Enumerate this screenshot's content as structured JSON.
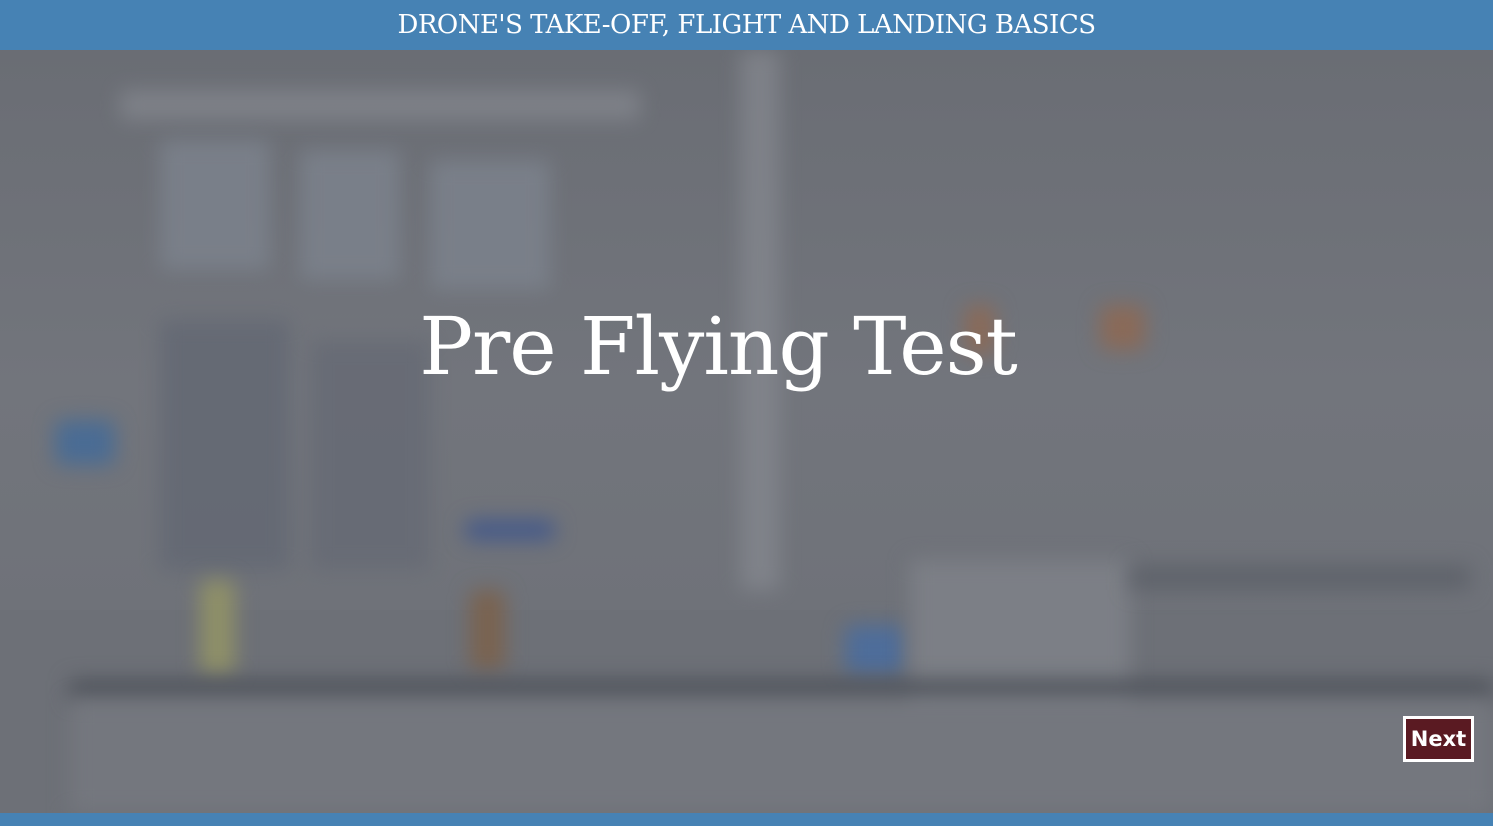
{
  "header": {
    "title": "DRONE'S TAKE-OFF, FLIGHT AND LANDING BASICS"
  },
  "slide": {
    "title": "Pre Flying Test"
  },
  "navigation": {
    "next_label": "Next"
  },
  "colors": {
    "header_bar": "#4682b4",
    "next_button_bg": "#5a1a22",
    "title_text": "#ffffff"
  }
}
